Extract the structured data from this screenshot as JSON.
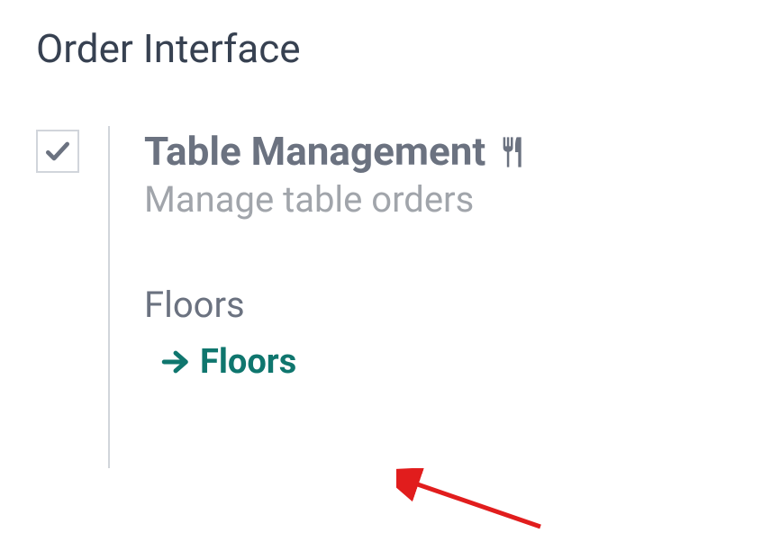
{
  "page": {
    "title": "Order Interface"
  },
  "setting": {
    "checked": true,
    "title": "Table Management",
    "subtitle": "Manage table orders",
    "field_label": "Floors",
    "link_label": "Floors"
  },
  "colors": {
    "accent": "#0f766e",
    "text_primary": "#374151",
    "text_secondary": "#6b7280",
    "text_muted": "#a1a5ab",
    "annotation": "#e11d1d"
  }
}
